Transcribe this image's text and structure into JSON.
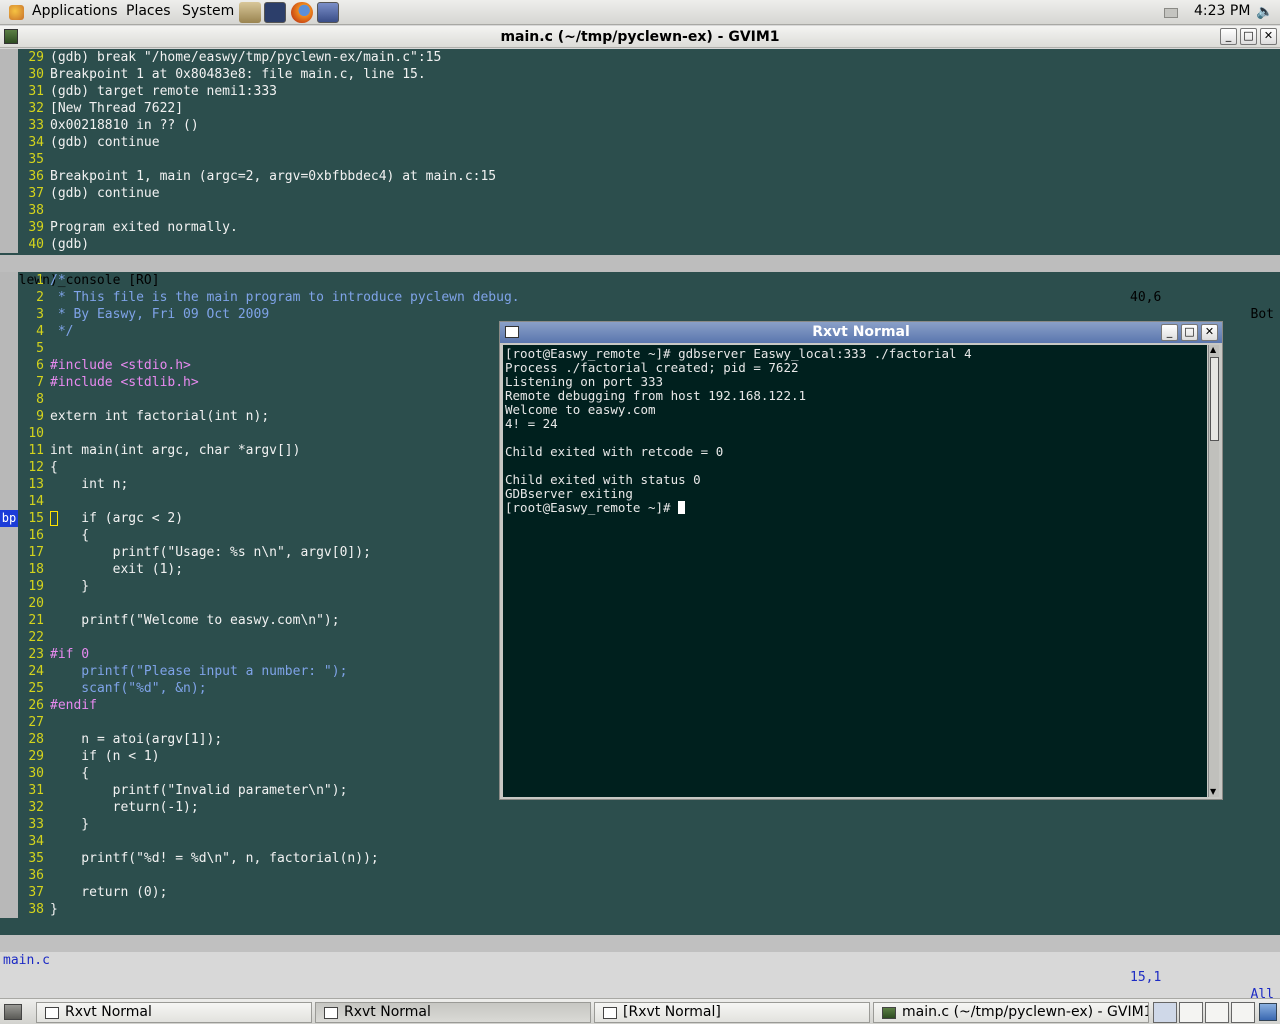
{
  "top_panel": {
    "menu": [
      "Applications",
      "Places",
      "System"
    ],
    "launchers": [
      "file-manager-icon",
      "terminal-icon",
      "firefox-icon",
      "gvim-launcher-icon"
    ],
    "clock": "4:23 PM"
  },
  "gvim": {
    "title": "main.c (~/tmp/pyclewn-ex) - GVIM1",
    "console": {
      "lines": [
        {
          "n": "29",
          "t": "(gdb) break \"/home/easwy/tmp/pyclewn-ex/main.c\":15"
        },
        {
          "n": "30",
          "t": "Breakpoint 1 at 0x80483e8: file main.c, line 15."
        },
        {
          "n": "31",
          "t": "(gdb) target remote nemi1:333"
        },
        {
          "n": "32",
          "t": "[New Thread 7622]"
        },
        {
          "n": "33",
          "t": "0x00218810 in ?? ()"
        },
        {
          "n": "34",
          "t": "(gdb) continue"
        },
        {
          "n": "35",
          "t": ""
        },
        {
          "n": "36",
          "t": "Breakpoint 1, main (argc=2, argv=0xbfbbdec4) at main.c:15"
        },
        {
          "n": "37",
          "t": "(gdb) continue"
        },
        {
          "n": "38",
          "t": ""
        },
        {
          "n": "39",
          "t": "Program exited normally."
        },
        {
          "n": "40",
          "t": "(gdb)"
        }
      ],
      "status_name": "(clewn)_console [RO]",
      "status_pos": "40,6",
      "status_pct": "Bot"
    },
    "source": {
      "sign_label": "bp",
      "lines": [
        {
          "n": "1",
          "t": "/*"
        },
        {
          "n": "2",
          "t": " * This file is the main program to introduce pyclewn debug."
        },
        {
          "n": "3",
          "t": " * By Easwy, Fri 09 Oct 2009"
        },
        {
          "n": "4",
          "t": " */"
        },
        {
          "n": "5",
          "t": ""
        },
        {
          "n": "6",
          "t": "#include <stdio.h>"
        },
        {
          "n": "7",
          "t": "#include <stdlib.h>"
        },
        {
          "n": "8",
          "t": ""
        },
        {
          "n": "9",
          "t": "extern int factorial(int n);"
        },
        {
          "n": "10",
          "t": ""
        },
        {
          "n": "11",
          "t": "int main(int argc, char *argv[])"
        },
        {
          "n": "12",
          "t": "{"
        },
        {
          "n": "13",
          "t": "    int n;"
        },
        {
          "n": "14",
          "t": ""
        },
        {
          "n": "15",
          "t": "    if (argc < 2)"
        },
        {
          "n": "16",
          "t": "    {"
        },
        {
          "n": "17",
          "t": "        printf(\"Usage: %s n\\n\", argv[0]);"
        },
        {
          "n": "18",
          "t": "        exit (1);"
        },
        {
          "n": "19",
          "t": "    }"
        },
        {
          "n": "20",
          "t": ""
        },
        {
          "n": "21",
          "t": "    printf(\"Welcome to easwy.com\\n\");"
        },
        {
          "n": "22",
          "t": ""
        },
        {
          "n": "23",
          "t": "#if 0"
        },
        {
          "n": "24",
          "t": "    printf(\"Please input a number: \");"
        },
        {
          "n": "25",
          "t": "    scanf(\"%d\", &n);"
        },
        {
          "n": "26",
          "t": "#endif"
        },
        {
          "n": "27",
          "t": ""
        },
        {
          "n": "28",
          "t": "    n = atoi(argv[1]);"
        },
        {
          "n": "29",
          "t": "    if (n < 1)"
        },
        {
          "n": "30",
          "t": "    {"
        },
        {
          "n": "31",
          "t": "        printf(\"Invalid parameter\\n\");"
        },
        {
          "n": "32",
          "t": "        return(-1);"
        },
        {
          "n": "33",
          "t": "    }"
        },
        {
          "n": "34",
          "t": ""
        },
        {
          "n": "35",
          "t": "    printf(\"%d! = %d\\n\", n, factorial(n));"
        },
        {
          "n": "36",
          "t": ""
        },
        {
          "n": "37",
          "t": "    return (0);"
        },
        {
          "n": "38",
          "t": "}"
        }
      ],
      "status_name": "main.c",
      "status_pos": "15,1",
      "status_pct": "All"
    }
  },
  "rxvt": {
    "title": "Rxvt Normal",
    "lines": [
      "[root@Easwy_remote ~]# gdbserver Easwy_local:333 ./factorial 4",
      "Process ./factorial created; pid = 7622",
      "Listening on port 333",
      "Remote debugging from host 192.168.122.1",
      "Welcome to easwy.com",
      "4! = 24",
      "",
      "Child exited with retcode = 0",
      "",
      "Child exited with status 0",
      "GDBserver exiting",
      "[root@Easwy_remote ~]# "
    ]
  },
  "taskbar": {
    "tasks": [
      "Rxvt Normal",
      "Rxvt Normal",
      "[Rxvt Normal]",
      "main.c (~/tmp/pyclewn-ex) - GVIM1"
    ]
  },
  "colors": {
    "vim_bg": "#2c4e4d",
    "line_number": "#d4d41c",
    "comment": "#7fa3e8",
    "preproc": "#e88af0",
    "type": "#9aea5a",
    "string": "#f79aa0",
    "keyword": "#ffd94c",
    "terminal_bg": "#00201e",
    "statusline_current_fg": "#1c2ac4"
  }
}
